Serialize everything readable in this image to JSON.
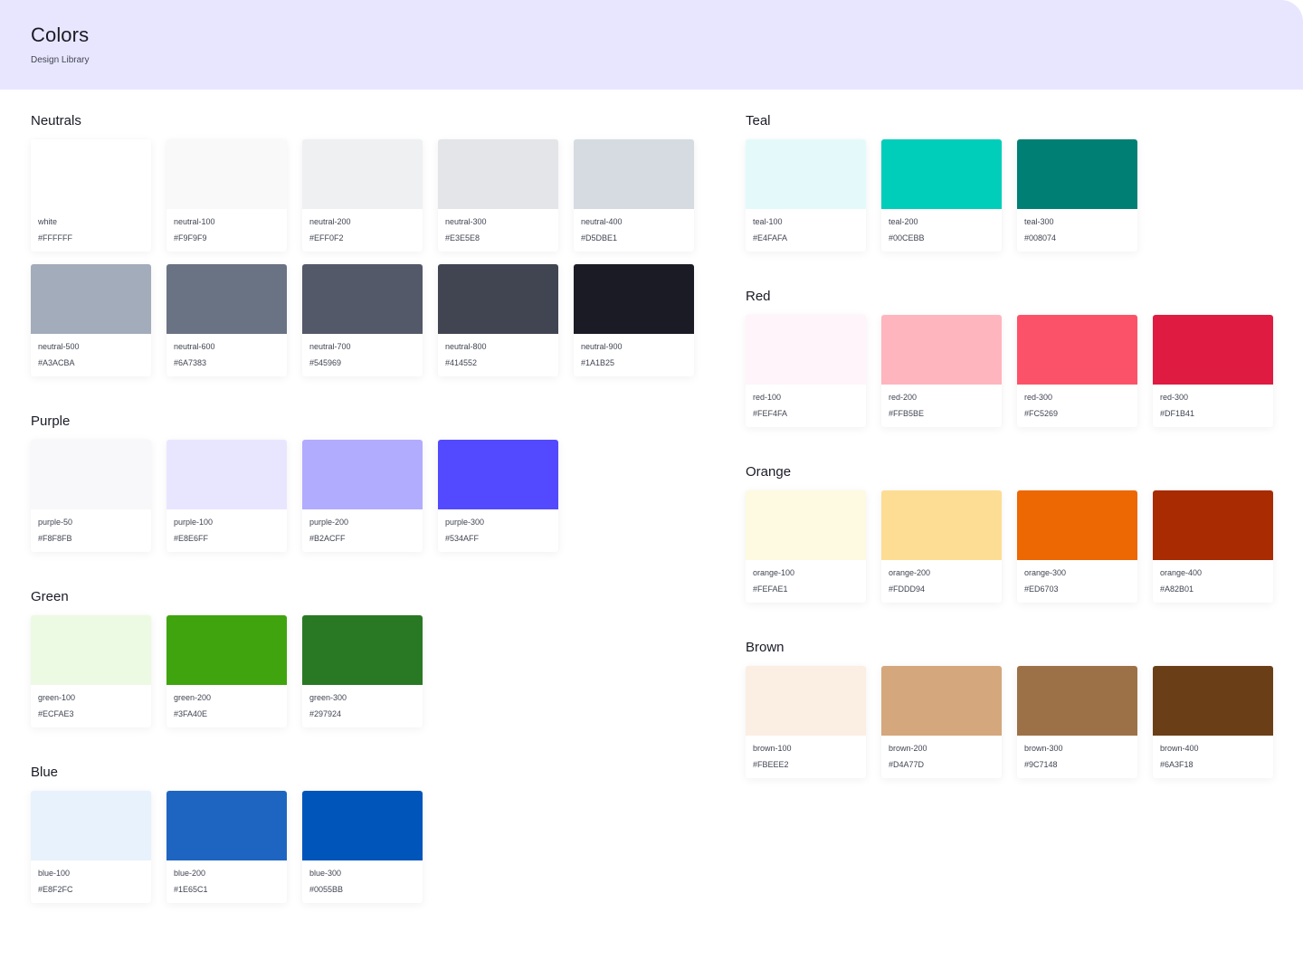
{
  "header": {
    "title": "Colors",
    "subtitle": "Design Library"
  },
  "groups": {
    "neutrals": {
      "title": "Neutrals",
      "colors": [
        {
          "name": "white",
          "hex": "#FFFFFF"
        },
        {
          "name": "neutral-100",
          "hex": "#F9F9F9"
        },
        {
          "name": "neutral-200",
          "hex": "#EFF0F2"
        },
        {
          "name": "neutral-300",
          "hex": "#E3E5E8"
        },
        {
          "name": "neutral-400",
          "hex": "#D5DBE1"
        },
        {
          "name": "neutral-500",
          "hex": "#A3ACBA"
        },
        {
          "name": "neutral-600",
          "hex": "#6A7383"
        },
        {
          "name": "neutral-700",
          "hex": "#545969"
        },
        {
          "name": "neutral-800",
          "hex": "#414552"
        },
        {
          "name": "neutral-900",
          "hex": "#1A1B25"
        }
      ]
    },
    "purple": {
      "title": "Purple",
      "colors": [
        {
          "name": "purple-50",
          "hex": "#F8F8FB"
        },
        {
          "name": "purple-100",
          "hex": "#E8E6FF"
        },
        {
          "name": "purple-200",
          "hex": "#B2ACFF"
        },
        {
          "name": "purple-300",
          "hex": "#534AFF"
        }
      ]
    },
    "green": {
      "title": "Green",
      "colors": [
        {
          "name": "green-100",
          "hex": "#ECFAE3"
        },
        {
          "name": "green-200",
          "hex": "#3FA40E"
        },
        {
          "name": "green-300",
          "hex": "#297924"
        }
      ]
    },
    "blue": {
      "title": "Blue",
      "colors": [
        {
          "name": "blue-100",
          "hex": "#E8F2FC"
        },
        {
          "name": "blue-200",
          "hex": "#1E65C1"
        },
        {
          "name": "blue-300",
          "hex": "#0055BB"
        }
      ]
    },
    "teal": {
      "title": "Teal",
      "colors": [
        {
          "name": "teal-100",
          "hex": "#E4FAFA"
        },
        {
          "name": "teal-200",
          "hex": "#00CEBB"
        },
        {
          "name": "teal-300",
          "hex": "#008074"
        }
      ]
    },
    "red": {
      "title": "Red",
      "colors": [
        {
          "name": "red-100",
          "hex": "#FEF4FA"
        },
        {
          "name": "red-200",
          "hex": "#FFB5BE"
        },
        {
          "name": "red-300",
          "hex": "#FC5269"
        },
        {
          "name": "red-300",
          "hex": "#DF1B41"
        }
      ]
    },
    "orange": {
      "title": "Orange",
      "colors": [
        {
          "name": "orange-100",
          "hex": "#FEFAE1"
        },
        {
          "name": "orange-200",
          "hex": "#FDDD94"
        },
        {
          "name": "orange-300",
          "hex": "#ED6703"
        },
        {
          "name": "orange-400",
          "hex": "#A82B01"
        }
      ]
    },
    "brown": {
      "title": "Brown",
      "colors": [
        {
          "name": "brown-100",
          "hex": "#FBEEE2"
        },
        {
          "name": "brown-200",
          "hex": "#D4A77D"
        },
        {
          "name": "brown-300",
          "hex": "#9C7148"
        },
        {
          "name": "brown-400",
          "hex": "#6A3F18"
        }
      ]
    }
  }
}
